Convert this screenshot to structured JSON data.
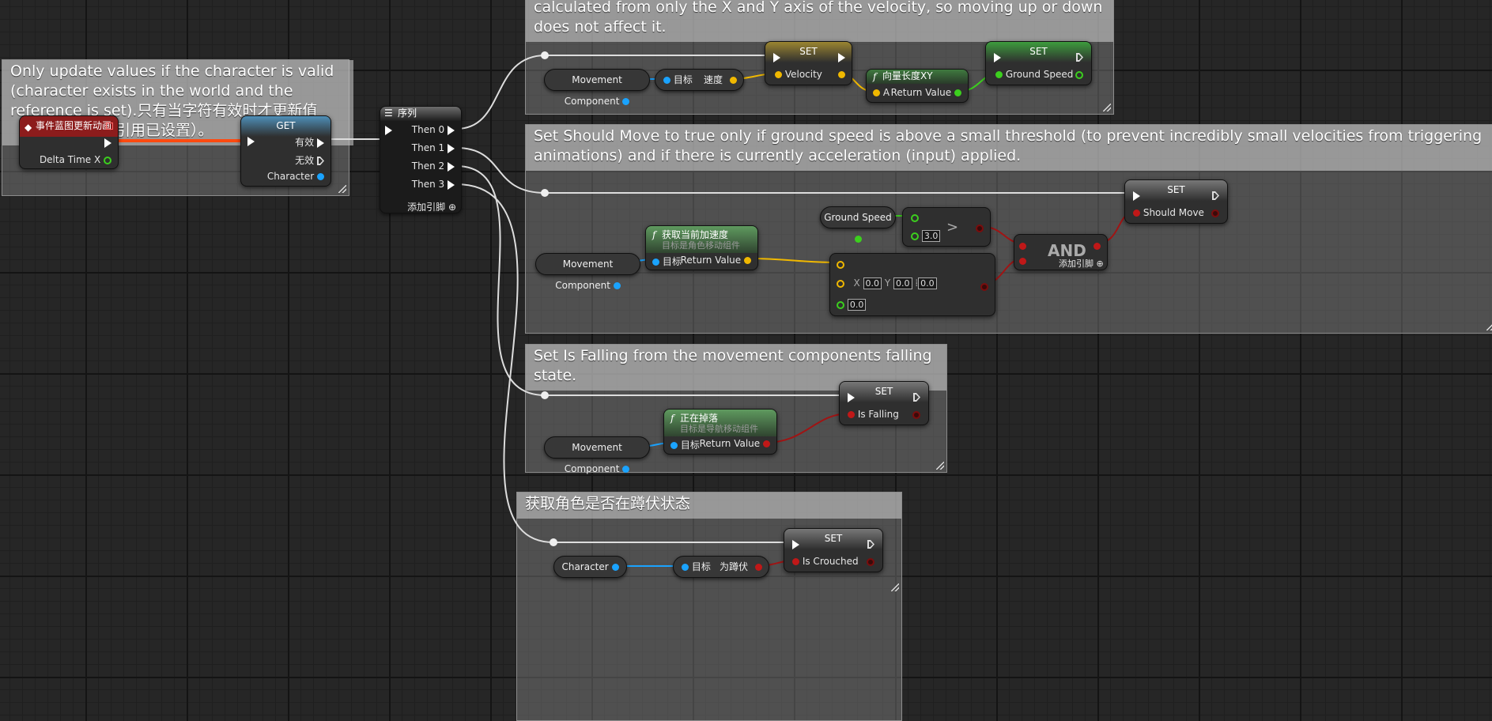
{
  "comments": {
    "c1": "Only update values if the character is valid (character exists in the world and the reference is set).只有当字符有效时才更新值（字符存在并且引用已设置）。",
    "c2": "calculated from only the X and Y axis of the velocity, so moving up or down does not affect it.",
    "c3": "Set Should Move to true only if ground speed is above a small threshold (to prevent incredibly small velocities from triggering animations) and if there is currently acceleration (input) applied.",
    "c4": "Set Is Falling from the movement components falling state.",
    "c5": "获取角色是否在蹲伏状态"
  },
  "event": {
    "title": "事件蓝图更新动画",
    "pin": "Delta Time X"
  },
  "get": {
    "title": "GET",
    "valid": "有效",
    "invalid": "无效",
    "pin": "Character"
  },
  "sequence": {
    "title": "序列",
    "then0": "Then 0",
    "then1": "Then 1",
    "then2": "Then 2",
    "then3": "Then 3",
    "add": "添加引脚"
  },
  "vel": {
    "mc": "Movement Component",
    "getvel": {
      "target": "目标",
      "out": "速度"
    },
    "set1": {
      "title": "SET",
      "pin": "Velocity"
    },
    "vlen": {
      "title": "向量长度XY",
      "a": "A",
      "rv": "Return Value"
    },
    "set2": {
      "title": "SET",
      "pin": "Ground Speed"
    }
  },
  "move": {
    "mc": "Movement Component",
    "accel": {
      "title": "获取当前加速度",
      "sub": "目标是角色移动组件",
      "target": "目标",
      "rv": "Return Value"
    },
    "gs": "Ground Speed",
    "gt": {
      "val": "3.0",
      "sym": ">"
    },
    "neq": {
      "x": "0.0",
      "y": "0.0",
      "z": "0.0",
      "tol": "0.0",
      "xl": "X",
      "yl": "Y"
    },
    "and": {
      "title": "AND",
      "add": "添加引脚"
    },
    "set": {
      "title": "SET",
      "pin": "Should Move"
    }
  },
  "fall": {
    "mc": "Movement Component",
    "fn": {
      "title": "正在掉落",
      "sub": "目标是导航移动组件",
      "target": "目标",
      "rv": "Return Value"
    },
    "set": {
      "title": "SET",
      "pin": "Is Falling"
    }
  },
  "crouch": {
    "ch": "Character",
    "fn": {
      "target": "目标",
      "out": "为蹲伏"
    },
    "set": {
      "title": "SET",
      "pin": "Is Crouched"
    }
  }
}
